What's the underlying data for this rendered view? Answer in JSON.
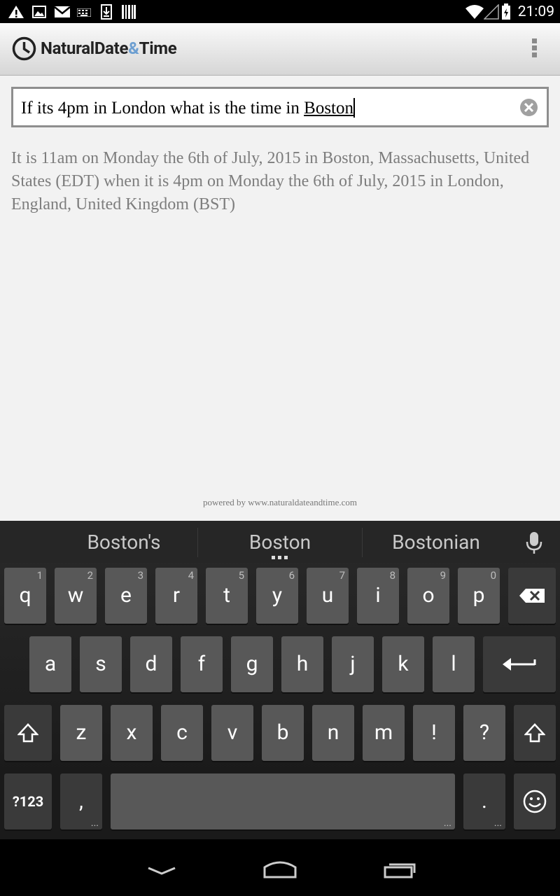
{
  "status_bar": {
    "time": "21:09",
    "notification_icons": [
      "warning-icon",
      "image-icon",
      "gmail-icon",
      "keyboard-icon",
      "download-icon",
      "barcode-icon"
    ],
    "system_icons": [
      "wifi-icon",
      "signal-icon",
      "battery-icon"
    ]
  },
  "action_bar": {
    "title_part1": "NaturalDate",
    "title_amp": "&",
    "title_part2": "Time",
    "accent_color": "#6d9fd1"
  },
  "query": {
    "text_before": "If its 4pm in London what is the time in ",
    "text_underlined": "Boston"
  },
  "result": {
    "text": "It is 11am on Monday the 6th of July, 2015 in Boston, Massachusetts, United States (EDT) when it is 4pm on Monday the 6th of July, 2015 in London, England, United Kingdom (BST)"
  },
  "footer": {
    "powered_by": "powered by www.naturaldateandtime.com"
  },
  "keyboard": {
    "suggestions": [
      "Boston's",
      "Boston",
      "Bostonian"
    ],
    "row1": [
      {
        "label": "q",
        "hint": "1"
      },
      {
        "label": "w",
        "hint": "2"
      },
      {
        "label": "e",
        "hint": "3"
      },
      {
        "label": "r",
        "hint": "4"
      },
      {
        "label": "t",
        "hint": "5"
      },
      {
        "label": "y",
        "hint": "6"
      },
      {
        "label": "u",
        "hint": "7"
      },
      {
        "label": "i",
        "hint": "8"
      },
      {
        "label": "o",
        "hint": "9"
      },
      {
        "label": "p",
        "hint": "0"
      }
    ],
    "row2": [
      "a",
      "s",
      "d",
      "f",
      "g",
      "h",
      "j",
      "k",
      "l"
    ],
    "row3": [
      "z",
      "x",
      "c",
      "v",
      "b",
      "n",
      "m",
      "!",
      "?"
    ],
    "symbols_label": "?123",
    "comma_label": ",",
    "period_label": ".",
    "more_dots": "..."
  }
}
